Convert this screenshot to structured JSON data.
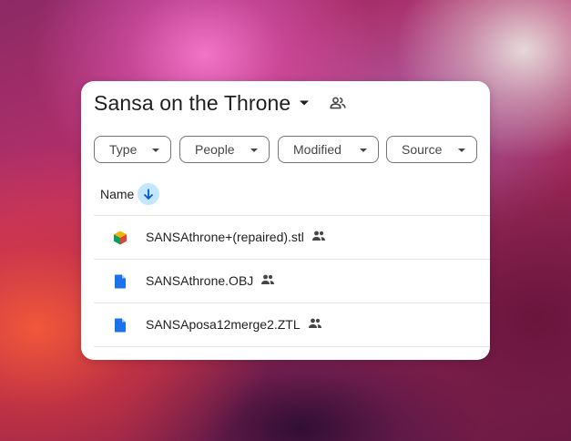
{
  "folder": {
    "title": "Sansa on the Throne",
    "caret_icon": "arrow-drop-down-icon",
    "share_icon": "shared-people-icon"
  },
  "filters": [
    {
      "label": "Type"
    },
    {
      "label": "People"
    },
    {
      "label": "Modified"
    },
    {
      "label": "Source"
    }
  ],
  "columns": {
    "name": "Name",
    "sort_direction": "descending"
  },
  "files": [
    {
      "name": "SANSAthrone+(repaired).stl",
      "icon": "3d-model-icon",
      "shared": true
    },
    {
      "name": "SANSAthrone.OBJ",
      "icon": "file-icon",
      "shared": true
    },
    {
      "name": "SANSAposa12merge2.ZTL",
      "icon": "file-icon",
      "shared": true
    }
  ],
  "colors": {
    "accent_blue": "#1a73e8",
    "sort_bg": "#c2e7ff",
    "text": "#1f1f1f",
    "chip_border": "#747775"
  }
}
